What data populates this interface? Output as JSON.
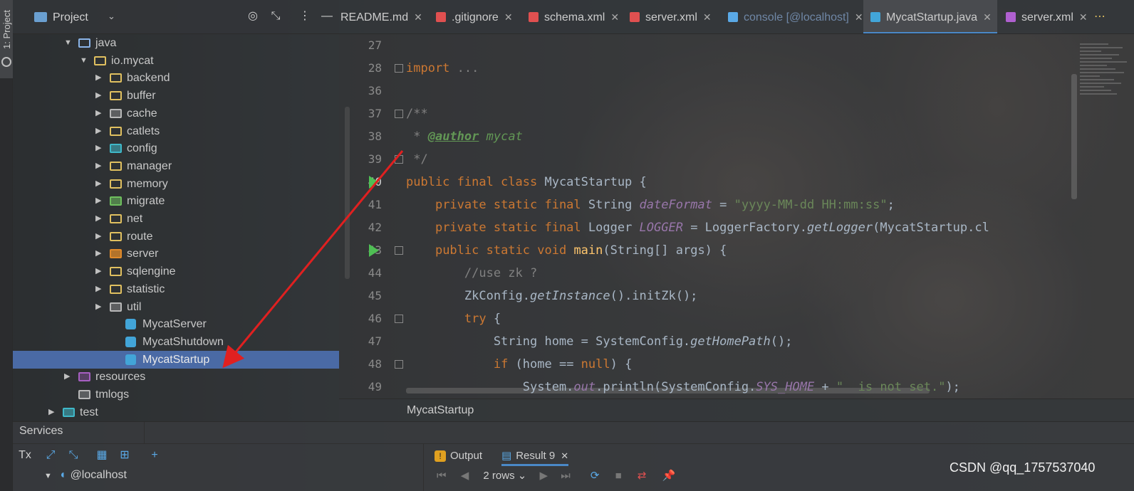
{
  "left_strip": {
    "label": "1: Project"
  },
  "project_panel": {
    "title": "Project",
    "tree": [
      {
        "label": "java",
        "kind": "folder-blue",
        "expanded": true
      },
      {
        "label": "io.mycat",
        "kind": "package",
        "expanded": true
      },
      {
        "label": "backend",
        "kind": "package"
      },
      {
        "label": "buffer",
        "kind": "package"
      },
      {
        "label": "cache",
        "kind": "package-gray"
      },
      {
        "label": "catlets",
        "kind": "package"
      },
      {
        "label": "config",
        "kind": "package-teal"
      },
      {
        "label": "manager",
        "kind": "package"
      },
      {
        "label": "memory",
        "kind": "package"
      },
      {
        "label": "migrate",
        "kind": "package-green"
      },
      {
        "label": "net",
        "kind": "package"
      },
      {
        "label": "route",
        "kind": "package"
      },
      {
        "label": "server",
        "kind": "package-orange"
      },
      {
        "label": "sqlengine",
        "kind": "package"
      },
      {
        "label": "statistic",
        "kind": "package"
      },
      {
        "label": "util",
        "kind": "package-gray"
      },
      {
        "label": "MycatServer",
        "kind": "class"
      },
      {
        "label": "MycatShutdown",
        "kind": "class"
      },
      {
        "label": "MycatStartup",
        "kind": "class",
        "selected": true
      },
      {
        "label": "resources",
        "kind": "resources"
      },
      {
        "label": "tmlogs",
        "kind": "folder-gray"
      },
      {
        "label": "test",
        "kind": "test-folder"
      }
    ]
  },
  "tabs": [
    {
      "label": "README.md",
      "active": false
    },
    {
      "label": ".gitignore",
      "active": false
    },
    {
      "label": "schema.xml",
      "active": false
    },
    {
      "label": "server.xml",
      "active": false
    },
    {
      "label": "console [@localhost]",
      "active": false,
      "muted": true
    },
    {
      "label": "MycatStartup.java",
      "active": true
    },
    {
      "label": "server.xml",
      "active": false
    }
  ],
  "editor": {
    "lines": [
      {
        "num": "27",
        "html": ""
      },
      {
        "num": "28",
        "html": "<span class=\"kw\">import</span> <span class=\"cmt\">...</span>"
      },
      {
        "num": "36",
        "html": ""
      },
      {
        "num": "37",
        "html": "<span class=\"cmt\">/**</span>"
      },
      {
        "num": "38",
        "html": "<span class=\"cmt\"> * </span><span class=\"doctag\">@author</span><span class=\"doc\"> mycat</span>"
      },
      {
        "num": "39",
        "html": "<span class=\"cmt\"> */</span>"
      },
      {
        "num": "40",
        "html": "<span class=\"kw\">public final class</span> MycatStartup {"
      },
      {
        "num": "41",
        "html": "    <span class=\"kw\">private static final</span> String <span class=\"fld\">dateFormat</span> = <span class=\"str\">\"yyyy-MM-dd HH:mm:ss\"</span>;"
      },
      {
        "num": "42",
        "html": "    <span class=\"kw\">private static final</span> Logger <span class=\"fld\">LOGGER</span> = LoggerFactory.<span class=\"ital\">getLogger</span>(MycatStartup.cl"
      },
      {
        "num": "43",
        "html": "    <span class=\"kw\">public static void</span> <span class=\"mth\">main</span>(String[] args) {"
      },
      {
        "num": "44",
        "html": "        <span class=\"cmt\">//use zk ?</span>"
      },
      {
        "num": "45",
        "html": "        ZkConfig.<span class=\"ital\">getInstance</span>().initZk();"
      },
      {
        "num": "46",
        "html": "        <span class=\"kw\">try</span> {"
      },
      {
        "num": "47",
        "html": "            String home = SystemConfig.<span class=\"ital\">getHomePath</span>();"
      },
      {
        "num": "48",
        "html": "            <span class=\"kw\">if</span> (home == <span class=\"kw\">null</span>) {"
      },
      {
        "num": "49",
        "html": "                System.<span class=\"fld\">out</span>.println(SystemConfig.<span class=\"fld\">SYS_HOME</span> + <span class=\"str\">\"  is not set.\"</span>);"
      }
    ],
    "current_line": "40"
  },
  "breadcrumb": "MycatStartup",
  "services": {
    "title": "Services",
    "tx_label": "Tx",
    "node": "@localhost",
    "output_tab": "Output",
    "result_tab": "Result 9",
    "rows_label": "2 rows"
  },
  "watermark": "CSDN @qq_1757537040",
  "colors": {
    "selection": "#4a6aa5",
    "accent": "#4a88c7",
    "annotation_arrow": "#e02020"
  }
}
